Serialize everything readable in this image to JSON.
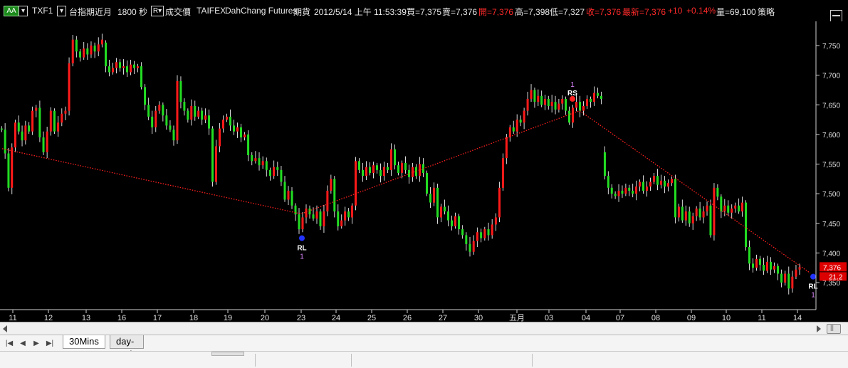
{
  "toolbar": {
    "aa_label": "AA",
    "symbol": "TXF1",
    "name": "台指期近月",
    "interval": "1800 秒",
    "r_label": "R",
    "price_type": "成交價",
    "exchange": "TAIFEX",
    "broker": "DahChang Futures",
    "category": "期貨",
    "datetime": "2012/5/14  上午 11:53:39",
    "bid": "買=7,375",
    "ask": "賣=7,376",
    "open": "開=7,376",
    "high": "高=7,398",
    "low": "低=7,327",
    "close": "收=7,376",
    "last": "最新=7,376",
    "change": "+10",
    "change_pct": "+0.14%",
    "volume": "量=69,100",
    "strategy": "策略"
  },
  "tabs": [
    {
      "label": "30Mins"
    },
    {
      "label": "day-trade"
    }
  ],
  "colors": {
    "up": "#ff1a1a",
    "down": "#22dd22",
    "zigzag": "#ff2020",
    "axis_text": "#e0e0e0",
    "marker_blue": "#2233ff",
    "marker_red": "#ff2020",
    "price_tag": "#dd0000"
  },
  "chart_data": {
    "type": "candlestick",
    "title": "",
    "ylim": [
      7300,
      7800
    ],
    "y_ticks": [
      "7,750",
      "7,700",
      "7,650",
      "7,600",
      "7,550",
      "7,500",
      "7,450",
      "7,400",
      "7,350"
    ],
    "x_ticks": [
      "11",
      "12",
      "13",
      "16",
      "17",
      "18",
      "19",
      "20",
      "23",
      "24",
      "25",
      "26",
      "27",
      "30",
      "五月",
      "03",
      "04",
      "07",
      "08",
      "09",
      "10",
      "11",
      "14"
    ],
    "last_price_tag": "7,376",
    "secondary_tag": "21.2",
    "zigzag": {
      "label": "",
      "points": [
        {
          "day": "11",
          "price": 7576
        },
        {
          "day": "23",
          "price": 7466
        },
        {
          "day": "04",
          "price": 7640
        },
        {
          "day": "14",
          "price": 7366
        }
      ]
    },
    "markers": [
      {
        "day": "23",
        "price": 7425,
        "text": "RL",
        "num": "1",
        "color": "blue",
        "position": "below"
      },
      {
        "day": "03",
        "price": 7660,
        "text": "RS",
        "num": "1",
        "color": "red",
        "position": "above"
      },
      {
        "day": "14",
        "price": 7360,
        "text": "RL",
        "num": "1",
        "color": "blue",
        "position": "below"
      }
    ],
    "days": [
      {
        "label": "11",
        "bars": 9,
        "start": 7610,
        "path": [
          7608,
          7568,
          7510,
          7578,
          7620,
          7605,
          7590,
          7615,
          7605
        ]
      },
      {
        "label": "12",
        "bars": 10,
        "start": 7605,
        "path": [
          7640,
          7645,
          7595,
          7570,
          7605,
          7640,
          7605,
          7620,
          7635,
          7640
        ]
      },
      {
        "label": "13",
        "bars": 10,
        "start": 7640,
        "path": [
          7720,
          7760,
          7740,
          7730,
          7745,
          7735,
          7750,
          7740,
          7752,
          7760
        ]
      },
      {
        "label": "16",
        "bars": 10,
        "start": 7755,
        "path": [
          7715,
          7705,
          7712,
          7722,
          7712,
          7715,
          7705,
          7718,
          7712,
          7715
        ]
      },
      {
        "label": "17",
        "bars": 10,
        "start": 7715,
        "path": [
          7680,
          7650,
          7630,
          7612,
          7640,
          7650,
          7632,
          7615,
          7608,
          7590
        ]
      },
      {
        "label": "18",
        "bars": 10,
        "start": 7590,
        "path": [
          7690,
          7655,
          7640,
          7625,
          7648,
          7630,
          7640,
          7625,
          7632,
          7610
        ]
      },
      {
        "label": "19",
        "bars": 10,
        "start": 7610,
        "path": [
          7520,
          7580,
          7610,
          7625,
          7630,
          7615,
          7605,
          7612,
          7595,
          7600
        ]
      },
      {
        "label": "20",
        "bars": 10,
        "start": 7600,
        "path": [
          7565,
          7555,
          7560,
          7548,
          7555,
          7540,
          7530,
          7545,
          7540,
          7520
        ]
      },
      {
        "label": "23",
        "bars": 10,
        "start": 7520,
        "path": [
          7490,
          7505,
          7480,
          7465,
          7440,
          7460,
          7475,
          7465,
          7458,
          7470
        ]
      },
      {
        "label": "24",
        "bars": 10,
        "start": 7470,
        "path": [
          7445,
          7470,
          7505,
          7525,
          7470,
          7445,
          7455,
          7470,
          7460,
          7480
        ]
      },
      {
        "label": "25",
        "bars": 10,
        "start": 7480,
        "path": [
          7555,
          7540,
          7530,
          7545,
          7535,
          7548,
          7540,
          7530,
          7545,
          7540
        ]
      },
      {
        "label": "26",
        "bars": 10,
        "start": 7540,
        "path": [
          7575,
          7548,
          7535,
          7552,
          7540,
          7528,
          7545,
          7530,
          7550,
          7535
        ]
      },
      {
        "label": "27",
        "bars": 10,
        "start": 7535,
        "path": [
          7500,
          7485,
          7510,
          7460,
          7478,
          7470,
          7455,
          7445,
          7462,
          7440
        ]
      },
      {
        "label": "30",
        "bars": 10,
        "start": 7440,
        "path": [
          7430,
          7415,
          7402,
          7420,
          7435,
          7425,
          7440,
          7430,
          7448,
          7460
        ]
      },
      {
        "label": "五月",
        "bars": 10,
        "start": 7460,
        "path": [
          7510,
          7560,
          7595,
          7612,
          7605,
          7625,
          7620,
          7640,
          7660,
          7675
        ]
      },
      {
        "label": "03",
        "bars": 10,
        "start": 7675,
        "path": [
          7655,
          7665,
          7650,
          7660,
          7648,
          7655,
          7642,
          7652,
          7660,
          7640
        ]
      },
      {
        "label": "04",
        "bars": 10,
        "start": 7640,
        "path": [
          7620,
          7645,
          7655,
          7640,
          7648,
          7660,
          7655,
          7670,
          7665,
          7660
        ]
      },
      {
        "label": "07",
        "bars": 10,
        "start": 7570,
        "path": [
          7530,
          7510,
          7500,
          7496,
          7505,
          7500,
          7510,
          7505,
          7500,
          7512
        ]
      },
      {
        "label": "08",
        "bars": 10,
        "start": 7512,
        "path": [
          7520,
          7505,
          7512,
          7520,
          7530,
          7515,
          7522,
          7512,
          7518,
          7525
        ]
      },
      {
        "label": "09",
        "bars": 10,
        "start": 7525,
        "path": [
          7460,
          7478,
          7455,
          7470,
          7450,
          7462,
          7475,
          7460,
          7470,
          7480
        ]
      },
      {
        "label": "10",
        "bars": 10,
        "start": 7480,
        "path": [
          7430,
          7510,
          7495,
          7470,
          7480,
          7468,
          7475,
          7480,
          7470,
          7485
        ]
      },
      {
        "label": "11",
        "bars": 10,
        "start": 7485,
        "path": [
          7410,
          7382,
          7375,
          7390,
          7380,
          7370,
          7385,
          7372,
          7378,
          7365
        ]
      },
      {
        "label": "14",
        "bars": 6,
        "start": 7365,
        "path": [
          7350,
          7365,
          7340,
          7360,
          7372,
          7376
        ]
      }
    ]
  }
}
